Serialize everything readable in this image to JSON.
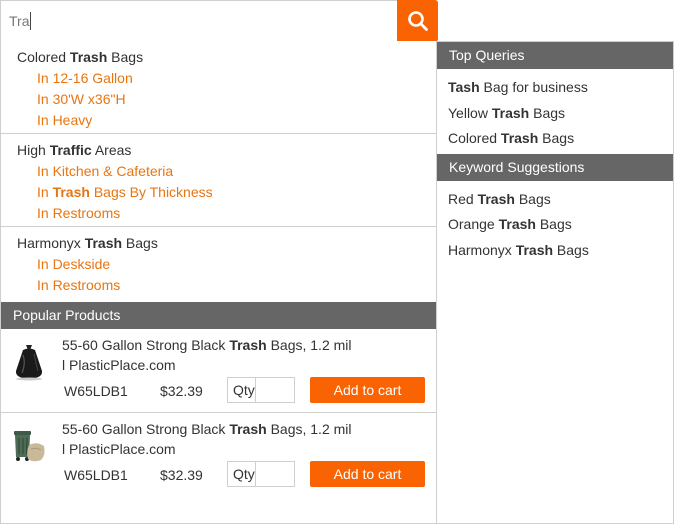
{
  "search": {
    "value": "Tra",
    "button_icon": "search-icon"
  },
  "categories": [
    {
      "title_pre": "Colored ",
      "title_hl": "Trash",
      "title_post": " Bags",
      "links": [
        {
          "pre": "In 12-16 Gallon",
          "hl": "",
          "post": ""
        },
        {
          "pre": "In 30'W x36\"H",
          "hl": "",
          "post": ""
        },
        {
          "pre": "In Heavy",
          "hl": "",
          "post": ""
        }
      ]
    },
    {
      "title_pre": "High ",
      "title_hl": "Traffic",
      "title_post": " Areas",
      "links": [
        {
          "pre": "In Kitchen & Cafeteria",
          "hl": "",
          "post": ""
        },
        {
          "pre": "In ",
          "hl": "Trash",
          "post": " Bags By Thickness"
        },
        {
          "pre": "In Restrooms",
          "hl": "",
          "post": ""
        }
      ]
    },
    {
      "title_pre": "Harmonyx ",
      "title_hl": "Trash",
      "title_post": " Bags",
      "links": [
        {
          "pre": "In Deskside",
          "hl": "",
          "post": ""
        },
        {
          "pre": "In Restrooms",
          "hl": "",
          "post": ""
        }
      ]
    }
  ],
  "popular": {
    "header": "Popular Products",
    "products": [
      {
        "title_pre": "55-60 Gallon Strong Black ",
        "title_hl": "Trash",
        "title_post": " Bags, 1.2 mil",
        "title_line2": "l PlasticPlace.com",
        "sku": "W65LDB1",
        "price": "$32.39",
        "qty_label": "Qty",
        "add_label": "Add to cart"
      },
      {
        "title_pre": "55-60 Gallon Strong Black ",
        "title_hl": "Trash",
        "title_post": " Bags, 1.2 mil",
        "title_line2": "l PlasticPlace.com",
        "sku": "W65LDB1",
        "price": "$32.39",
        "qty_label": "Qty",
        "add_label": "Add to cart"
      }
    ]
  },
  "top_queries": {
    "header": "Top Queries",
    "items": [
      {
        "pre": "",
        "hl": "Tash",
        "post": " Bag for business"
      },
      {
        "pre": "Yellow ",
        "hl": "Trash",
        "post": " Bags"
      },
      {
        "pre": "Colored ",
        "hl": "Trash",
        "post": " Bags"
      }
    ]
  },
  "keyword_suggestions": {
    "header": "Keyword Suggestions",
    "items": [
      {
        "pre": "Red ",
        "hl": "Trash",
        "post": " Bags"
      },
      {
        "pre": "Orange ",
        "hl": "Trash",
        "post": " Bags"
      },
      {
        "pre": "Harmonyx ",
        "hl": "Trash",
        "post": " Bags"
      }
    ]
  },
  "colors": {
    "accent": "#f96302",
    "link": "#e87510",
    "header_bg": "#666666",
    "border": "#cfcfcf"
  }
}
